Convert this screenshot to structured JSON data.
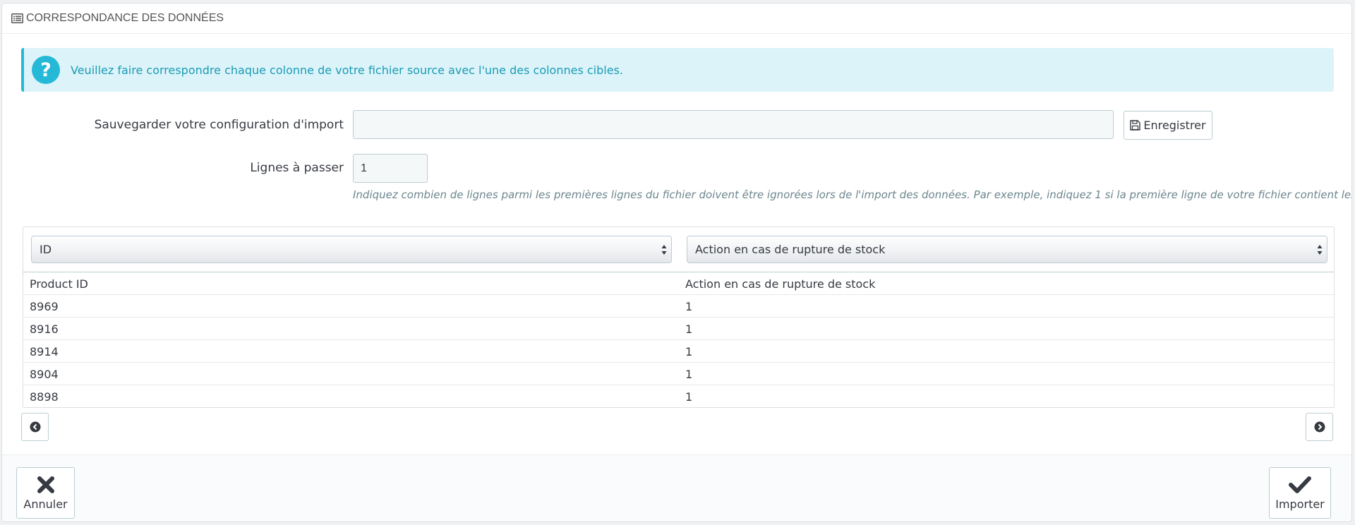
{
  "panel": {
    "title": "CORRESPONDANCE DES DONNÉES",
    "title_icon": "list-icon"
  },
  "alert": {
    "icon": "question-icon",
    "icon_glyph": "?",
    "text": "Veuillez faire correspondre chaque colonne de votre fichier source avec l'une des colonnes cibles.",
    "accent_color": "#25b9d7"
  },
  "form": {
    "config_label": "Sauvegarder votre configuration d'import",
    "config_value": "",
    "config_placeholder": "",
    "save_button_label": "Enregistrer",
    "save_button_icon": "floppy-disk-icon",
    "skip_label": "Lignes à passer",
    "skip_value": "1",
    "skip_help": "Indiquez combien de lignes parmi les premières lignes du fichier doivent être ignorées lors de l'import des données. Par exemple, indiquez 1 si la première ligne de votre fichier contient les en-têtes."
  },
  "mapping": {
    "selects": [
      {
        "selected": "ID"
      },
      {
        "selected": "Action en cas de rupture de stock"
      }
    ],
    "rows": [
      [
        "Product ID",
        "Action en cas de rupture de stock"
      ],
      [
        "8969",
        "1"
      ],
      [
        "8916",
        "1"
      ],
      [
        "8914",
        "1"
      ],
      [
        "8904",
        "1"
      ],
      [
        "8898",
        "1"
      ]
    ],
    "prev_icon": "chevron-left-circle-icon",
    "next_icon": "chevron-right-circle-icon"
  },
  "footer": {
    "cancel_label": "Annuler",
    "cancel_icon": "close-icon",
    "import_label": "Importer",
    "import_icon": "check-icon"
  }
}
